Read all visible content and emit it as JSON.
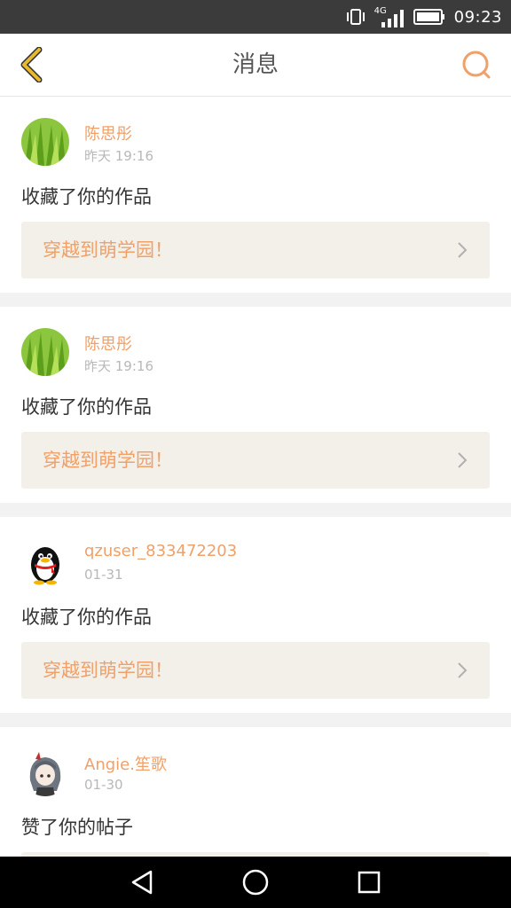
{
  "status_bar": {
    "network_label": "4G",
    "time": "09:23",
    "icons": [
      "vibrate-icon",
      "signal-icon",
      "battery-icon"
    ]
  },
  "header": {
    "title": "消息",
    "back_icon": "chevron-left-icon",
    "search_icon": "search-icon"
  },
  "messages": [
    {
      "username": "陈思彤",
      "time": "昨天 19:16",
      "action": "收藏了你的作品",
      "link": "穿越到萌学园！",
      "avatar": "grass"
    },
    {
      "username": "陈思彤",
      "time": "昨天 19:16",
      "action": "收藏了你的作品",
      "link": "穿越到萌学园！",
      "avatar": "grass"
    },
    {
      "username": "qzuser_833472203",
      "time": "01-31",
      "action": "收藏了你的作品",
      "link": "穿越到萌学园！",
      "avatar": "penguin"
    },
    {
      "username": "Angie.笙歌",
      "time": "01-30",
      "action": "赞了你的帖子",
      "link": "",
      "avatar": "anime-girl"
    }
  ],
  "colors": {
    "accent": "#f0a069",
    "link_bg": "#f2f0e9",
    "separator": "#f2f2f2",
    "back_icon": "#e8b82e"
  },
  "nav_bar": {
    "icons": [
      "back-triangle-icon",
      "home-circle-icon",
      "recents-square-icon"
    ]
  }
}
